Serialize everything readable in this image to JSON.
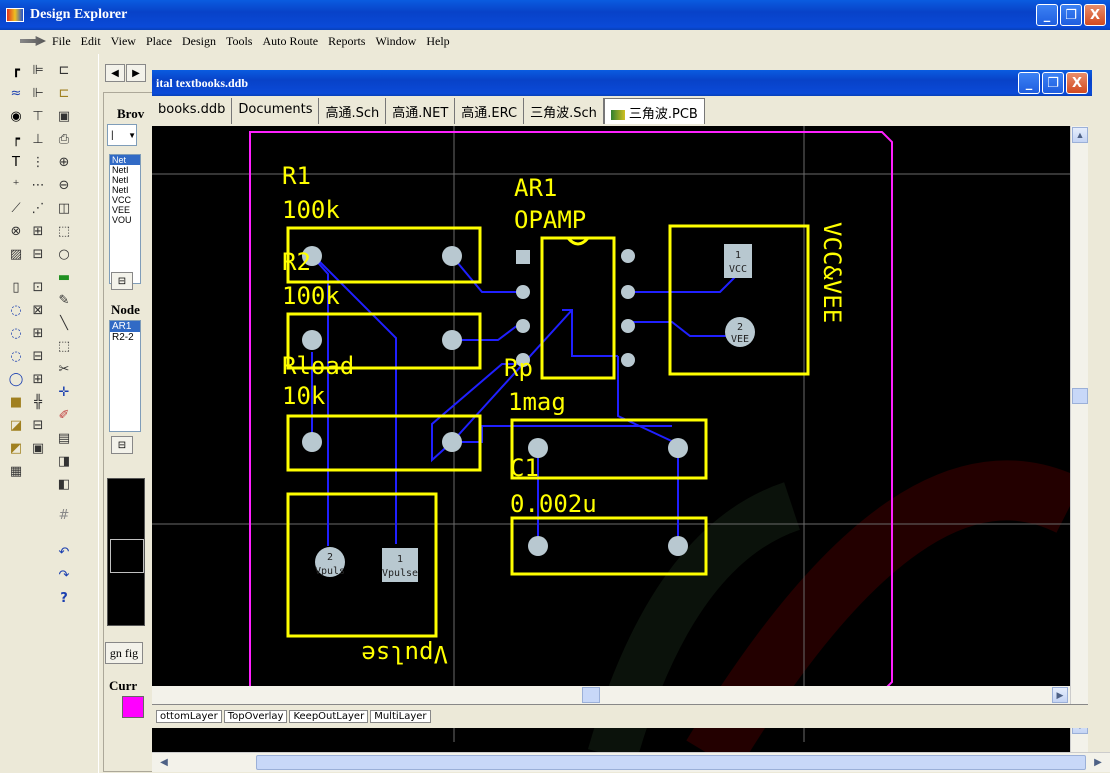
{
  "app": {
    "title": "Design Explorer"
  },
  "window_buttons": {
    "minimize": "_",
    "maximize": "❐",
    "close": "X"
  },
  "menu": [
    "File",
    "Edit",
    "View",
    "Place",
    "Design",
    "Tools",
    "Auto Route",
    "Reports",
    "Window",
    "Help"
  ],
  "browser": {
    "label": "Brov",
    "select_value": "|",
    "net_items": [
      "Net",
      "NetI",
      "NetI",
      "NetI",
      "VCC",
      "VEE",
      "VOU"
    ],
    "node_label": "Node",
    "node_items": [
      "AR1",
      "R2-2"
    ],
    "zoom_button": "gn fig",
    "current_label": "Curr",
    "current_color": "#ff00ff"
  },
  "document": {
    "title": "ital textbooks.ddb",
    "tabs": [
      "books.ddb",
      "Documents",
      "高通.Sch",
      "高通.NET",
      "高通.ERC",
      "三角波.Sch",
      "三角波.PCB"
    ],
    "active_tab": "三角波.PCB",
    "layer_tabs": [
      "ottomLayer",
      "TopOverlay",
      "KeepOutLayer",
      "MultiLayer"
    ]
  },
  "pcb": {
    "components": [
      {
        "ref": "R1",
        "value": "100k"
      },
      {
        "ref": "R2",
        "value": "100k"
      },
      {
        "ref": "Rload",
        "value": "10k"
      },
      {
        "ref": "AR1",
        "value": "OPAMP"
      },
      {
        "ref": "Rp",
        "value": "1mag"
      },
      {
        "ref": "C1",
        "value": "0.002u"
      }
    ],
    "power_label": "VCC&VEE",
    "pulse_label": "Vpulse",
    "pads": {
      "vcc_num": "1",
      "vcc_name": "VCC",
      "vee_num": "2",
      "vee_name": "VEE",
      "vp1_num": "1",
      "vp1_name": "Vpulse",
      "vp2_num": "2",
      "vp2_name": "Vpuls"
    },
    "colors": {
      "overlay": "#ffff00",
      "track": "#2020ff",
      "pad": "#c0c0c0",
      "keepout": "#ff20ff",
      "grid": "#707070"
    }
  }
}
